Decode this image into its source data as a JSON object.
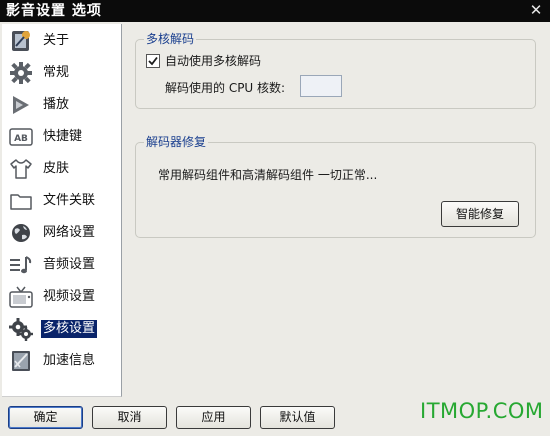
{
  "window": {
    "title": "影音设置 选项"
  },
  "sidebar": {
    "items": [
      {
        "label": "关于",
        "icon": "about-icon"
      },
      {
        "label": "常规",
        "icon": "gear-icon"
      },
      {
        "label": "播放",
        "icon": "play-icon"
      },
      {
        "label": "快捷键",
        "icon": "keyboard-icon"
      },
      {
        "label": "皮肤",
        "icon": "tshirt-icon"
      },
      {
        "label": "文件关联",
        "icon": "folder-icon"
      },
      {
        "label": "网络设置",
        "icon": "globe-icon"
      },
      {
        "label": "音频设置",
        "icon": "audio-icon"
      },
      {
        "label": "视频设置",
        "icon": "tv-icon"
      },
      {
        "label": "多核设置",
        "icon": "multicore-icon",
        "selected": true
      },
      {
        "label": "加速信息",
        "icon": "accelerate-icon"
      }
    ]
  },
  "multicore": {
    "group_title": "多核解码",
    "enable_label": "自动使用多核解码",
    "enable_checked": true,
    "core_count_label": "解码使用的 CPU 核数:",
    "core_count_value": ""
  },
  "repair": {
    "group_title": "解码器修复",
    "status_text": "常用解码组件和高清解码组件 一切正常...",
    "button_label": "智能修复"
  },
  "footer": {
    "ok_label": "确定",
    "cancel_label": "取消",
    "apply_label": "应用",
    "default_label": "默认值",
    "watermark": "ITMOP.COM"
  },
  "colors": {
    "titlebar": "#0b0b0b",
    "selection": "#0a246a",
    "group_title": "#1a3f8f",
    "watermark": "#27a832"
  }
}
